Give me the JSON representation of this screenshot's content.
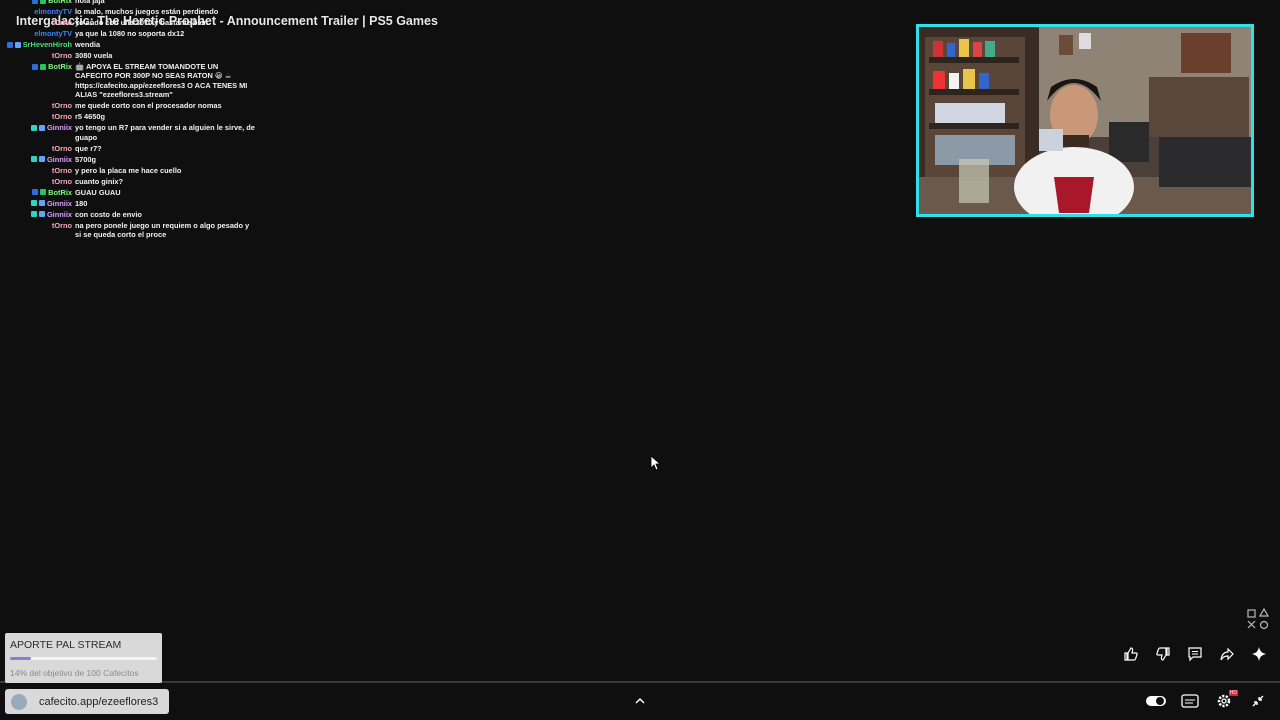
{
  "video": {
    "title": "Intergalactic: The Heretic Prophet - Announcement Trailer | PS5 Games"
  },
  "chat": [
    {
      "user": "BotRix",
      "color": "#7cfc7c",
      "badges": [
        "#2d6cdf",
        "#22c55e"
      ],
      "msg": "hola jaja"
    },
    {
      "user": "elmontyTV",
      "color": "#3b82f6",
      "badges": [],
      "msg": "lo malo, muchos juegos están perdiendo"
    },
    {
      "user": "tOrno",
      "color": "#f4a6c0",
      "badges": [],
      "msg": "yo ando con una 3070 y bastante bien"
    },
    {
      "user": "elmontyTV",
      "color": "#3b82f6",
      "badges": [],
      "msg": "ya que la 1080 no soporta dx12"
    },
    {
      "user": "SrHevenHiroh",
      "color": "#4ade80",
      "badges": [
        "#2d6cdf",
        "#60a5fa"
      ],
      "msg": "wendia"
    },
    {
      "user": "tOrno",
      "color": "#f4a6c0",
      "badges": [],
      "msg": "3080 vuela"
    },
    {
      "user": "BotRix",
      "color": "#7cfc7c",
      "badges": [
        "#2d6cdf",
        "#22c55e"
      ],
      "msg": "🤖 APOYA EL STREAM TOMANDOTE UN CAFECITO POR 300P NO SEAS RATON 😀 ☕ https://cafecito.app/ezeeflores3 O ACA TENES MI ALIAS \"ezeeflores3.stream\""
    },
    {
      "user": "tOrno",
      "color": "#f4a6c0",
      "badges": [],
      "msg": "me quede corto con el procesador nomas"
    },
    {
      "user": "tOrno",
      "color": "#f4a6c0",
      "badges": [],
      "msg": "r5 4650g"
    },
    {
      "user": "Ginniix",
      "color": "#d4a0ff",
      "badges": [
        "#2dd4bf",
        "#60a5fa"
      ],
      "msg": "yo tengo un R7 para vender si a alguien le sirve, de guapo"
    },
    {
      "user": "tOrno",
      "color": "#f4a6c0",
      "badges": [],
      "msg": "que r7?"
    },
    {
      "user": "Ginniix",
      "color": "#d4a0ff",
      "badges": [
        "#2dd4bf",
        "#60a5fa"
      ],
      "msg": "5700g"
    },
    {
      "user": "tOrno",
      "color": "#f4a6c0",
      "badges": [],
      "msg": "y pero la placa me hace cuello"
    },
    {
      "user": "tOrno",
      "color": "#f4a6c0",
      "badges": [],
      "msg": "cuanto ginix?"
    },
    {
      "user": "BotRix",
      "color": "#7cfc7c",
      "badges": [
        "#2d6cdf",
        "#22c55e"
      ],
      "msg": "GUAU GUAU"
    },
    {
      "user": "Ginniix",
      "color": "#d4a0ff",
      "badges": [
        "#2dd4bf",
        "#60a5fa"
      ],
      "msg": "180"
    },
    {
      "user": "Ginniix",
      "color": "#d4a0ff",
      "badges": [
        "#2dd4bf",
        "#60a5fa"
      ],
      "msg": "con costo de envio"
    },
    {
      "user": "tOrno",
      "color": "#f4a6c0",
      "badges": [],
      "msg": "na pero ponele juego un requiem o algo pesado y si se queda corto el proce"
    }
  ],
  "donation": {
    "title": "APORTE PAL STREAM",
    "subtitle": "14% del objetivo de 100 Cafecitos",
    "progress": 0.14,
    "fill_color": "#8d7bd8"
  },
  "url_pill": {
    "text": "cafecito.app/ezeeflores3"
  },
  "icons": {
    "actions": [
      "thumbs-up-icon",
      "thumbs-down-icon",
      "comment-icon",
      "share-icon",
      "sparkle-icon"
    ],
    "bottom": [
      "toggle-icon",
      "subtitles-icon",
      "settings-icon",
      "exit-fullscreen-icon"
    ]
  },
  "settings_badge": "HD",
  "webcam_border_color": "#2fe0e6"
}
